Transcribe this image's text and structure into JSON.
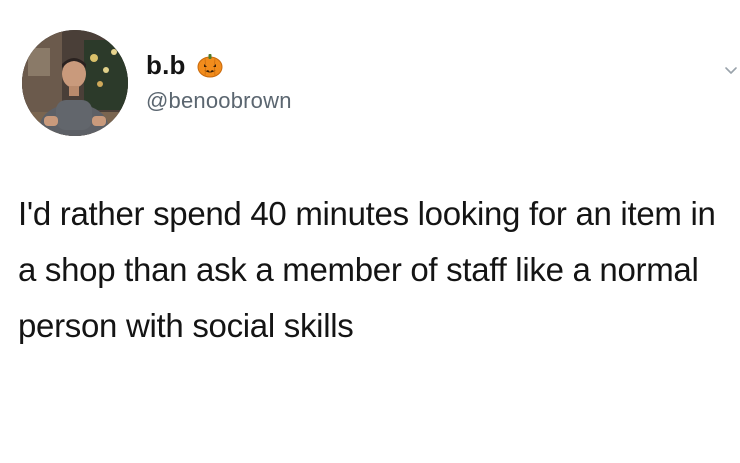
{
  "tweet": {
    "author": {
      "display_name": "b.b",
      "handle": "@benoobrown",
      "name_emoji_icon": "jack-o-lantern-icon"
    },
    "more_icon": "chevron-down-icon",
    "text": "I'd rather spend 40 minutes looking for an item in a shop than ask a member of staff like a normal person with social skills"
  },
  "colors": {
    "text": "#141414",
    "handle": "#5b6670",
    "background": "#ffffff",
    "pumpkin": "#f28c1c"
  }
}
